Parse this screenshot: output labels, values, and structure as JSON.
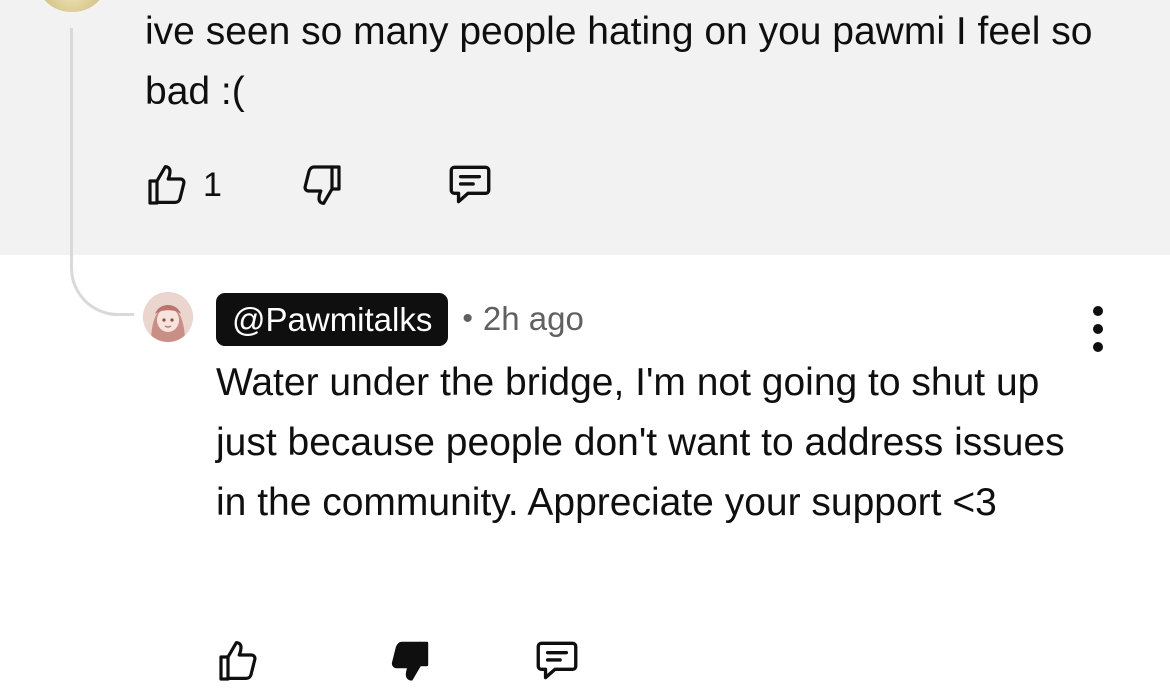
{
  "parent_comment": {
    "text": "ive seen so many people hating on you pawmi I feel so bad :(",
    "like_count": "1",
    "icons": {
      "like": "thumbs-up-outline-icon",
      "dislike": "thumbs-down-outline-icon",
      "reply": "reply-comment-icon"
    }
  },
  "reply": {
    "handle": "@Pawmitalks",
    "separator": "•",
    "timestamp": "2h ago",
    "text": "Water under the bridge, I'm not going to shut up just because people don't want to address issues in the community. Appreciate your support <3",
    "dislike_active": true,
    "icons": {
      "like": "thumbs-up-outline-icon",
      "dislike": "thumbs-down-filled-icon",
      "reply": "reply-comment-icon",
      "more": "more-vertical-icon"
    }
  },
  "colors": {
    "highlight_background": "#f2f2f2",
    "text_primary": "#0f0f0f",
    "text_secondary": "#606060",
    "badge_background": "#0f0f0f",
    "badge_text": "#ffffff"
  }
}
